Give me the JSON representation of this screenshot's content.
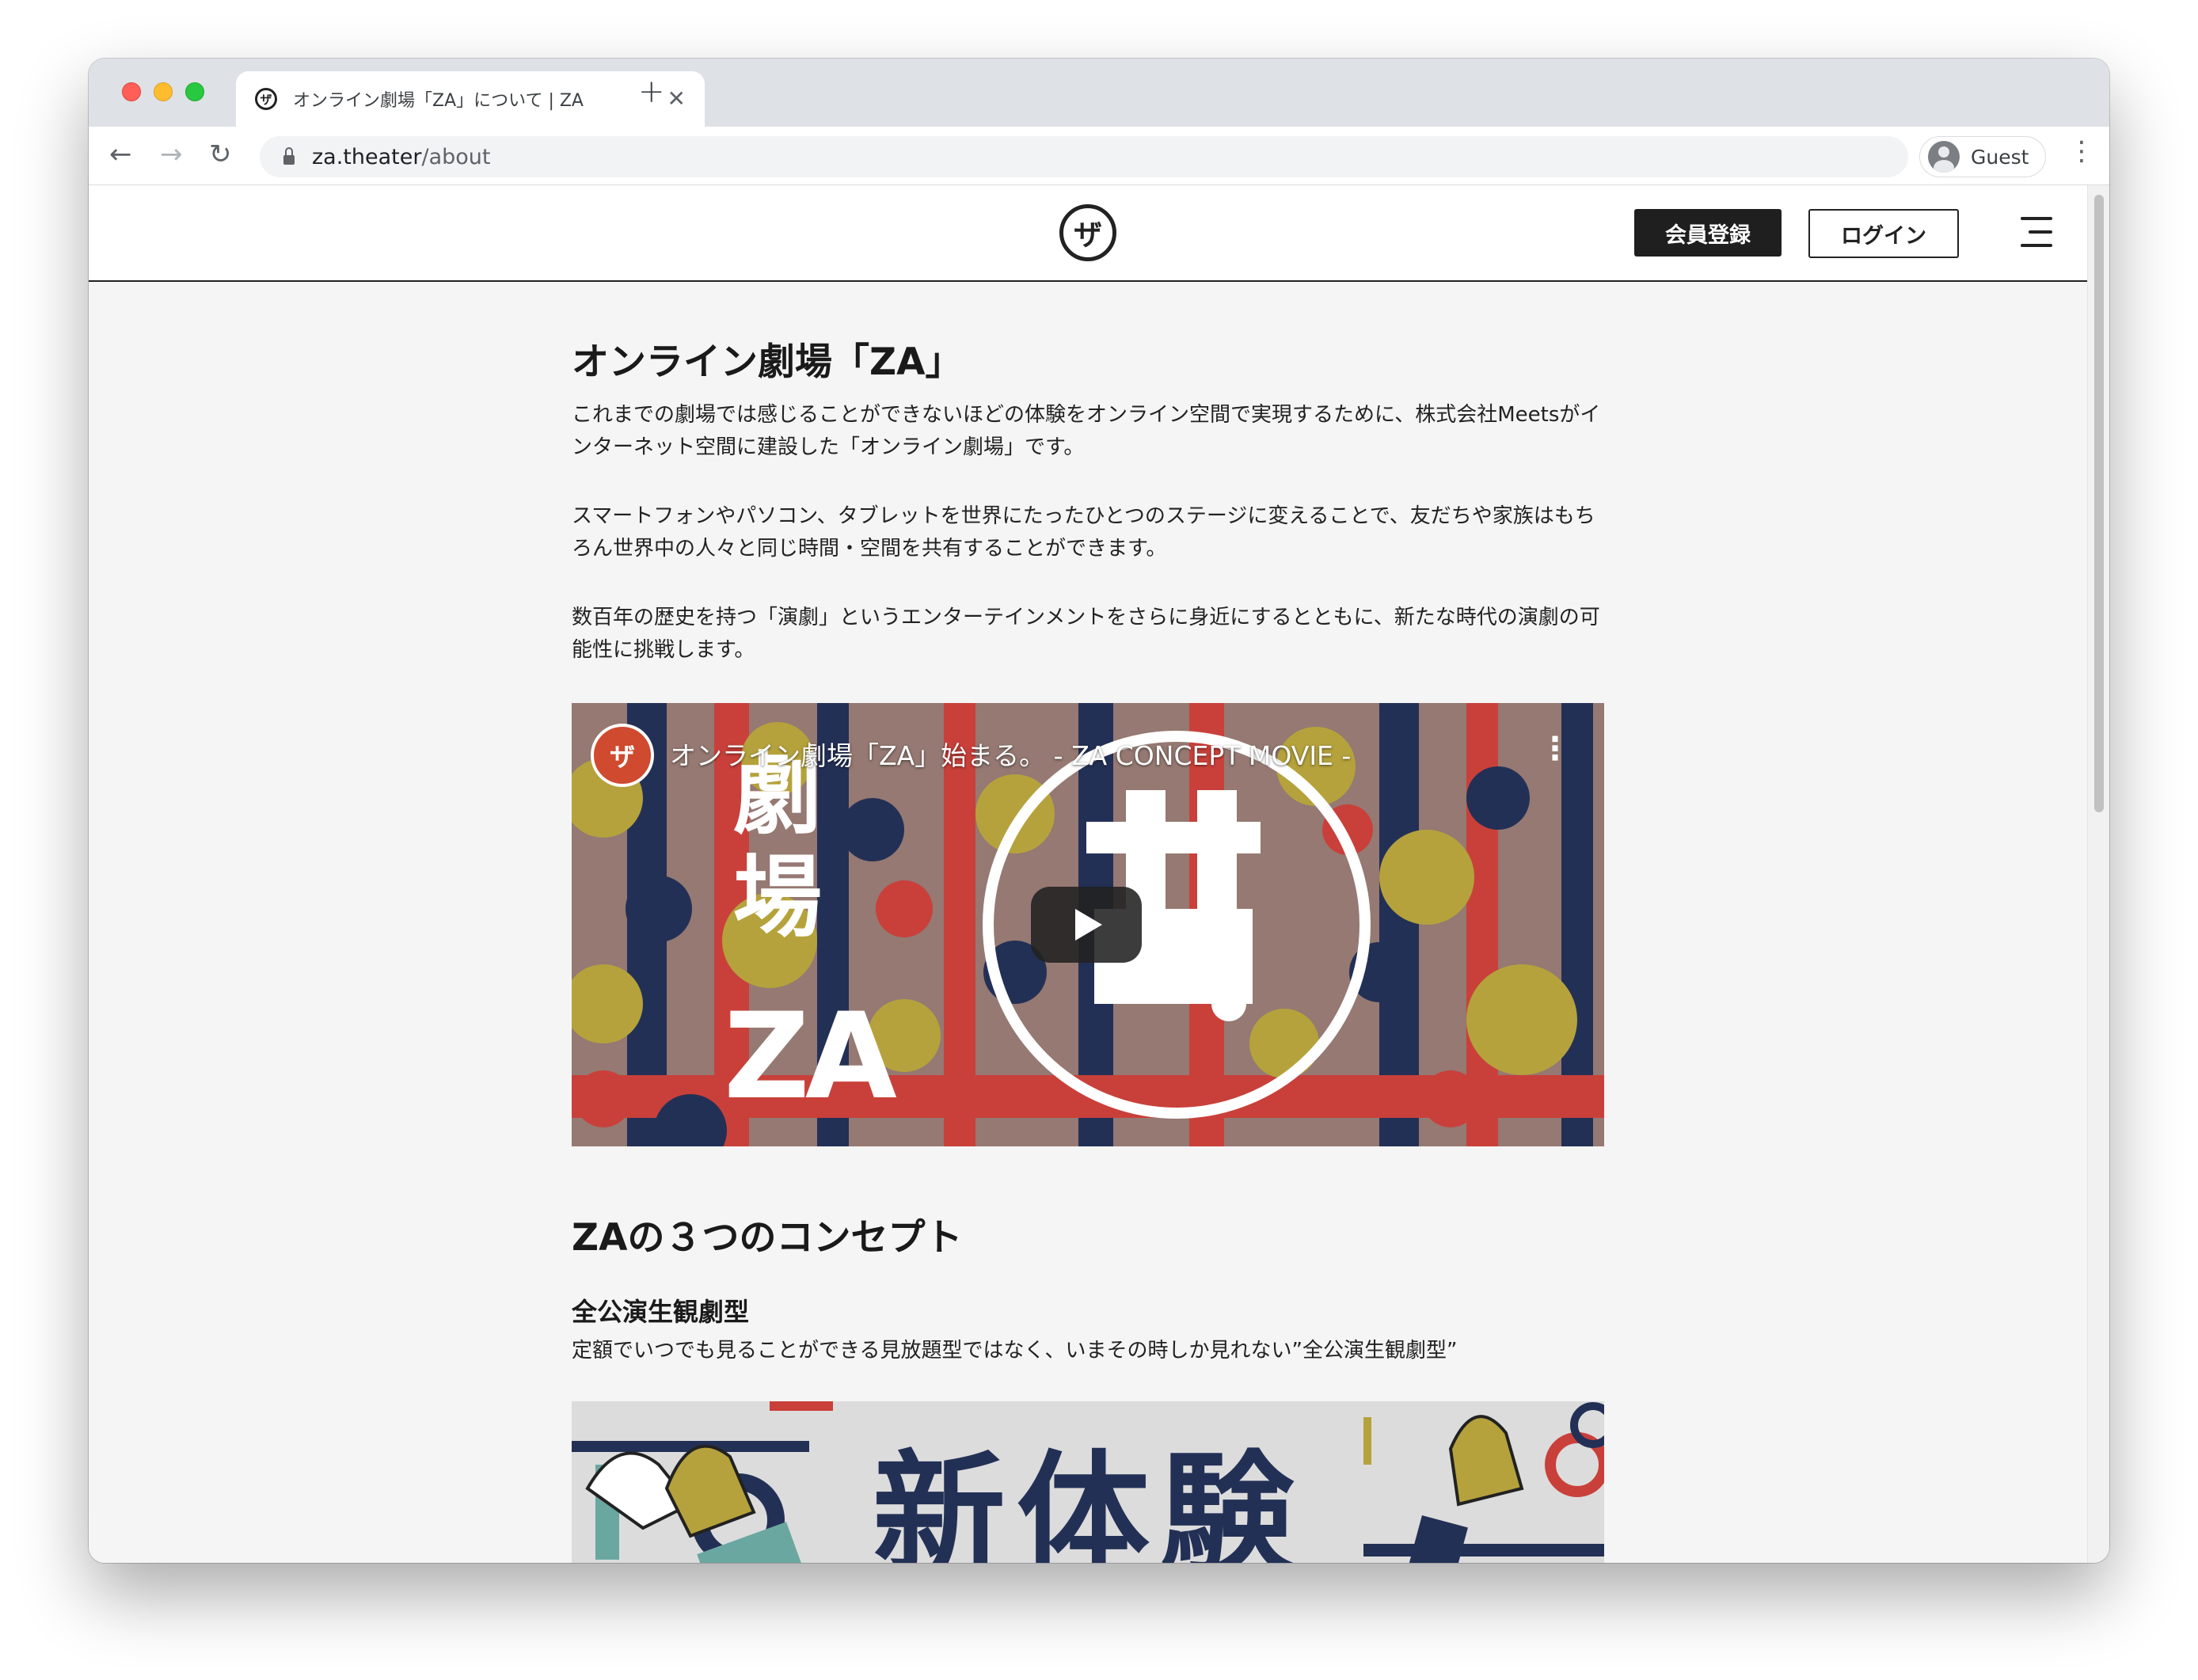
{
  "browser": {
    "tab_title": "オンライン劇場「ZA」について | ZA",
    "new_tab_symbol": "+",
    "close_symbol": "✕",
    "url_host": "za.theater",
    "url_path": "/about",
    "profile_name": "Guest"
  },
  "header": {
    "logo_glyph": "ザ",
    "register_label": "会員登録",
    "login_label": "ログイン"
  },
  "main": {
    "title": "オンライン劇場「ZA」",
    "paragraphs": [
      "これまでの劇場では感じることができないほどの体験をオンライン空間で実現するために、株式会社Meetsがインターネット空間に建設した「オンライン劇場」です。",
      "スマートフォンやパソコン、タブレットを世界にたったひとつのステージに変えることで、友だちや家族はもちろん世界中の人々と同じ時間・空間を共有することができます。",
      "数百年の歴史を持つ「演劇」というエンターテインメントをさらに身近にするとともに、新たな時代の演劇の可能性に挑戦します。"
    ],
    "video": {
      "title": "オンライン劇場「ZA」始まる。 - ZA CONCEPT MOVIE -",
      "thumbnail_text_line1": "劇",
      "thumbnail_text_line2": "場",
      "thumbnail_text_line3": "ZA"
    },
    "concepts_title": "ZAの３つのコンセプト",
    "concept1": {
      "title": "全公演生観劇型",
      "description": "定額でいつでも見ることができる見放題型ではなく、いまその時しか見れない”全公演生観劇型”"
    },
    "banner_text": "新体験"
  },
  "colors": {
    "navy": "#233056",
    "red": "#c9403a",
    "mustard": "#b5a23c",
    "teal": "#6aa7a0",
    "dark": "#1f1f1f"
  }
}
